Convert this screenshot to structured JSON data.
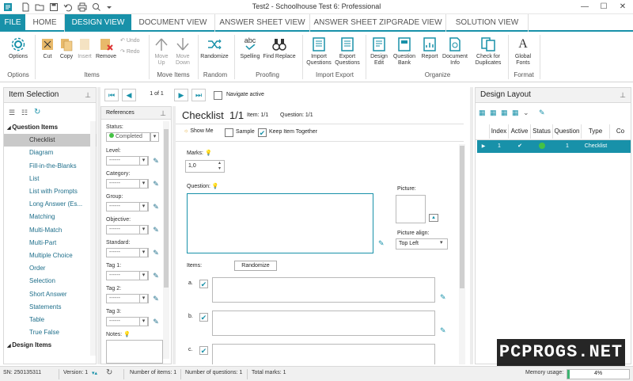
{
  "window": {
    "title": "Test2 - Schoolhouse Test 6: Professional",
    "minimize": "—",
    "maximize": "☐",
    "close": "✕"
  },
  "tabs": [
    "FILE",
    "HOME",
    "DESIGN VIEW",
    "DOCUMENT VIEW",
    "ANSWER SHEET VIEW",
    "ANSWER SHEET ZIPGRADE VIEW",
    "SOLUTION VIEW"
  ],
  "ribbon": {
    "options": "Options",
    "cut": "Cut",
    "copy": "Copy",
    "insert": "Insert",
    "remove": "Remove",
    "undo": "Undo",
    "redo": "Redo",
    "move_up": [
      "Move",
      "Up"
    ],
    "move_down": [
      "Move",
      "Down"
    ],
    "randomize": "Randomize",
    "spelling": "Spelling",
    "find_replace": "Find Replace",
    "import_questions": [
      "Import",
      "Questions"
    ],
    "export_questions": [
      "Export",
      "Questions"
    ],
    "design_edit": [
      "Design",
      "Edit"
    ],
    "question_bank": [
      "Question",
      "Bank"
    ],
    "report": "Report",
    "document_info": [
      "Document",
      "Info"
    ],
    "check_duplicates": [
      "Check for",
      "Duplicates"
    ],
    "global_fonts": [
      "Global",
      "Fonts"
    ],
    "groups": {
      "options": "Options",
      "items": "Items",
      "move_items": "Move Items",
      "random": "Random",
      "proofing": "Proofing",
      "import_export": "Import Export",
      "organize": "Organize",
      "format": "Format"
    }
  },
  "left_panel": {
    "title": "Item Selection",
    "items": [
      {
        "label": "Question Items",
        "type": "cat"
      },
      {
        "label": "Checklist",
        "type": "sel"
      },
      {
        "label": "Diagram",
        "type": "item"
      },
      {
        "label": "Fill-in-the-Blanks",
        "type": "item"
      },
      {
        "label": "List",
        "type": "item"
      },
      {
        "label": "List with Prompts",
        "type": "item"
      },
      {
        "label": "Long Answer (Es...",
        "type": "item"
      },
      {
        "label": "Matching",
        "type": "item"
      },
      {
        "label": "Multi-Match",
        "type": "item"
      },
      {
        "label": "Multi-Part",
        "type": "item"
      },
      {
        "label": "Multiple Choice",
        "type": "item"
      },
      {
        "label": "Order",
        "type": "item"
      },
      {
        "label": "Selection",
        "type": "item"
      },
      {
        "label": "Short Answer",
        "type": "item"
      },
      {
        "label": "Statements",
        "type": "item"
      },
      {
        "label": "Table",
        "type": "item"
      },
      {
        "label": "True False",
        "type": "item"
      },
      {
        "label": "Design Items",
        "type": "cat"
      }
    ]
  },
  "nav": {
    "page": "1 of 1",
    "navigate_active": "Navigate active"
  },
  "references": {
    "title": "References",
    "status_label": "Status:",
    "status_value": "Completed",
    "fields": [
      "Level:",
      "Category:",
      "Group:",
      "Objective:",
      "Standard:",
      "Tag 1:",
      "Tag 2:",
      "Tag 3:"
    ],
    "placeholder": "------",
    "notes_label": "Notes:"
  },
  "editor": {
    "title": "Checklist",
    "counter": "1/1",
    "item_info": "Item: 1/1",
    "question_info": "Question: 1/1",
    "show_me": "Show Me",
    "sample": "Sample",
    "keep_together": "Keep Item Together",
    "marks_label": "Marks:",
    "marks_value": "1,0",
    "question_label": "Question:",
    "picture_label": "Picture:",
    "picture_align_label": "Picture align:",
    "picture_align_value": "Top Left",
    "items_label": "Items:",
    "randomize_btn": "Randomize",
    "item_letters": [
      "a.",
      "b.",
      "c."
    ]
  },
  "right_panel": {
    "title": "Design Layout",
    "columns": [
      "Index",
      "Active",
      "Status",
      "Question",
      "Type",
      "Co"
    ],
    "row": {
      "index": "1",
      "active": "✔",
      "question": "1",
      "type": "Checklist"
    }
  },
  "status": {
    "sn": "SN: 250135311",
    "version": "Version: 1",
    "items": "Number of items: 1",
    "questions": "Number of questions: 1",
    "marks": "Total marks: 1",
    "memory_label": "Memory usage:",
    "memory_value": "4%"
  },
  "watermark": "PCPROGS.NET",
  "colors": {
    "accent": "#1891a9",
    "status_green": "#44c244"
  }
}
